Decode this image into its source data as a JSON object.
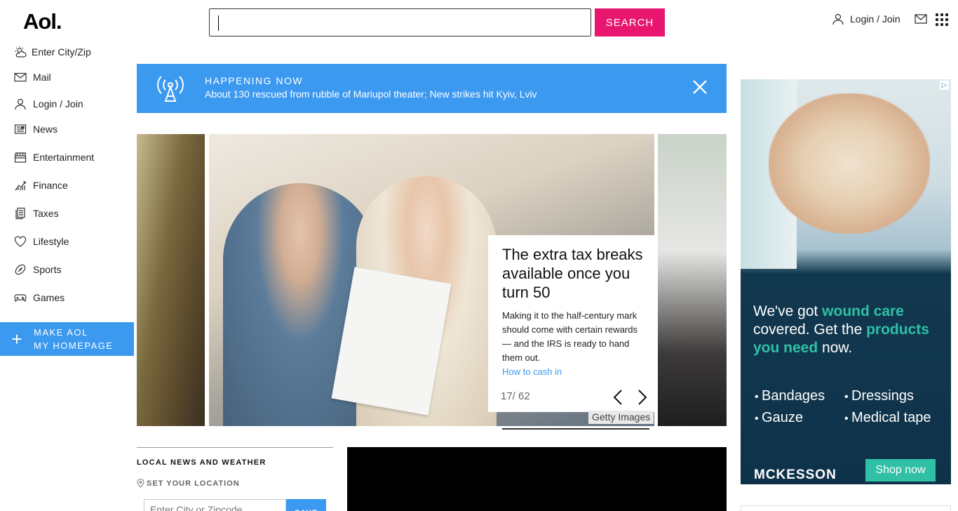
{
  "header": {
    "logo": "Aol.",
    "search_value": "",
    "search_button": "SEARCH",
    "login": "Login / Join"
  },
  "sidebar": {
    "items": [
      {
        "label": "Enter City/Zip",
        "icon": "weather-icon"
      },
      {
        "label": "Mail",
        "icon": "mail-icon"
      },
      {
        "label": "Login / Join",
        "icon": "user-icon"
      },
      {
        "label": "News",
        "icon": "news-icon"
      },
      {
        "label": "Entertainment",
        "icon": "clapper-icon"
      },
      {
        "label": "Finance",
        "icon": "chart-icon"
      },
      {
        "label": "Taxes",
        "icon": "document-icon"
      },
      {
        "label": "Lifestyle",
        "icon": "heart-icon"
      },
      {
        "label": "Sports",
        "icon": "football-icon"
      },
      {
        "label": "Games",
        "icon": "gamepad-icon"
      }
    ],
    "make_home_line1": "MAKE AOL",
    "make_home_line2": "MY HOMEPAGE"
  },
  "banner": {
    "title": "HAPPENING NOW",
    "text": "About 130 rescued from rubble of Mariupol theater; New strikes hit Kyiv, Lviv"
  },
  "carousel": {
    "headline": "The extra tax breaks available once you turn 50",
    "summary": "Making it to the half-century mark should come with certain rewards — and the IRS is ready to hand them out.",
    "link": "How to cash in",
    "pager": "17/ 62",
    "credit": "Getty Images"
  },
  "local": {
    "title": "LOCAL NEWS AND WEATHER",
    "set_location": "SET YOUR LOCATION",
    "input_placeholder": "Enter City or Zipcode",
    "save": "SAVE"
  },
  "ad": {
    "line1": "We've got ",
    "line1_hl": "wound care",
    "line2": " covered. Get the ",
    "line2_hl": "products you need",
    "line3": " now.",
    "items": [
      "Bandages",
      "Dressings",
      "Gauze",
      "Medical tape"
    ],
    "brand": "MCKESSON",
    "cta": "Shop now"
  },
  "colors": {
    "accent_pink": "#e8166f",
    "accent_blue": "#3b99f0",
    "ad_green": "#2fc0a6",
    "ad_navy": "#0e3249"
  }
}
